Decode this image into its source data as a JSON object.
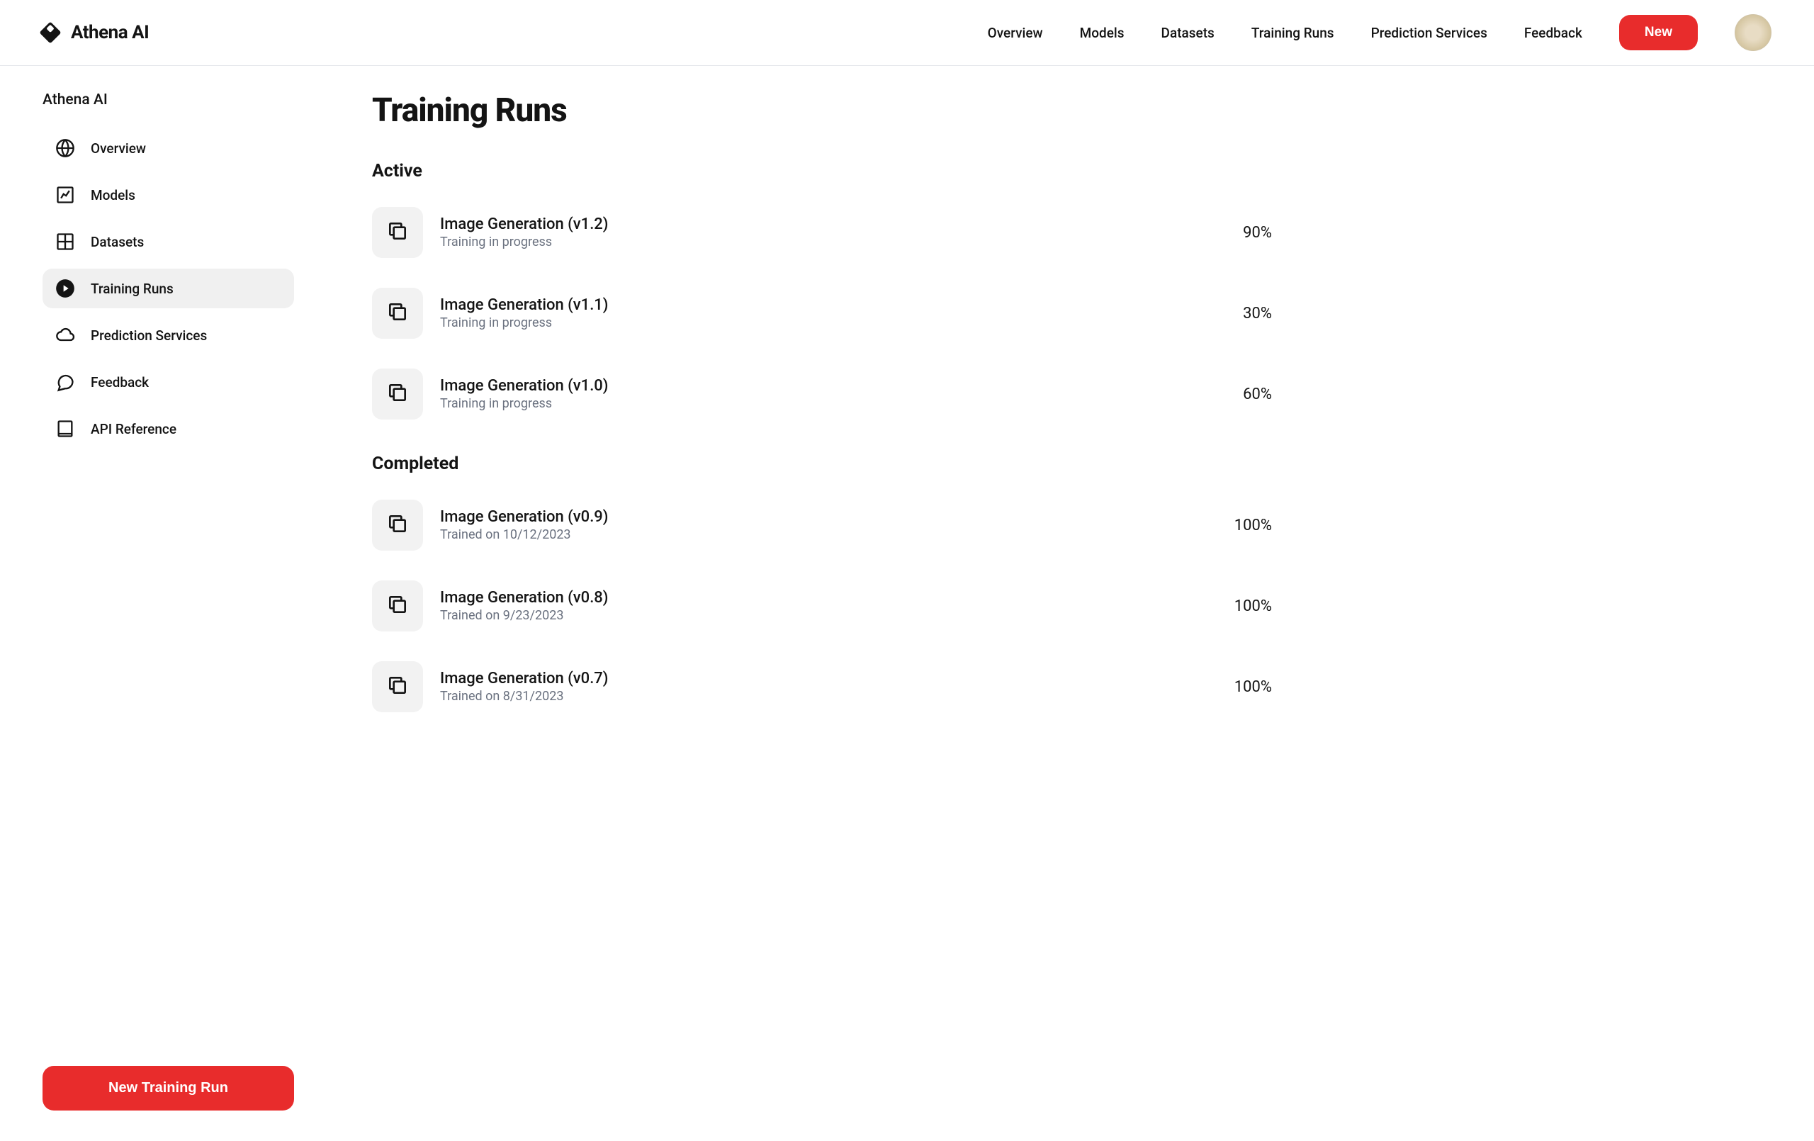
{
  "header": {
    "logo_text": "Athena AI",
    "nav": [
      "Overview",
      "Models",
      "Datasets",
      "Training Runs",
      "Prediction Services",
      "Feedback"
    ],
    "new_button": "New"
  },
  "sidebar": {
    "title": "Athena AI",
    "items": [
      {
        "label": "Overview",
        "icon": "globe-icon",
        "active": false
      },
      {
        "label": "Models",
        "icon": "chart-icon",
        "active": false
      },
      {
        "label": "Datasets",
        "icon": "grid-icon",
        "active": false
      },
      {
        "label": "Training Runs",
        "icon": "play-icon",
        "active": true
      },
      {
        "label": "Prediction Services",
        "icon": "cloud-icon",
        "active": false
      },
      {
        "label": "Feedback",
        "icon": "chat-icon",
        "active": false
      },
      {
        "label": "API Reference",
        "icon": "book-icon",
        "active": false
      }
    ],
    "new_run_button": "New Training Run"
  },
  "main": {
    "title": "Training Runs",
    "sections": [
      {
        "title": "Active",
        "runs": [
          {
            "name": "Image Generation (v1.2)",
            "status": "Training in progress",
            "percent": "90%"
          },
          {
            "name": "Image Generation (v1.1)",
            "status": "Training in progress",
            "percent": "30%"
          },
          {
            "name": "Image Generation (v1.0)",
            "status": "Training in progress",
            "percent": "60%"
          }
        ]
      },
      {
        "title": "Completed",
        "runs": [
          {
            "name": "Image Generation (v0.9)",
            "status": "Trained on 10/12/2023",
            "percent": "100%"
          },
          {
            "name": "Image Generation (v0.8)",
            "status": "Trained on 9/23/2023",
            "percent": "100%"
          },
          {
            "name": "Image Generation (v0.7)",
            "status": "Trained on 8/31/2023",
            "percent": "100%"
          }
        ]
      }
    ]
  }
}
